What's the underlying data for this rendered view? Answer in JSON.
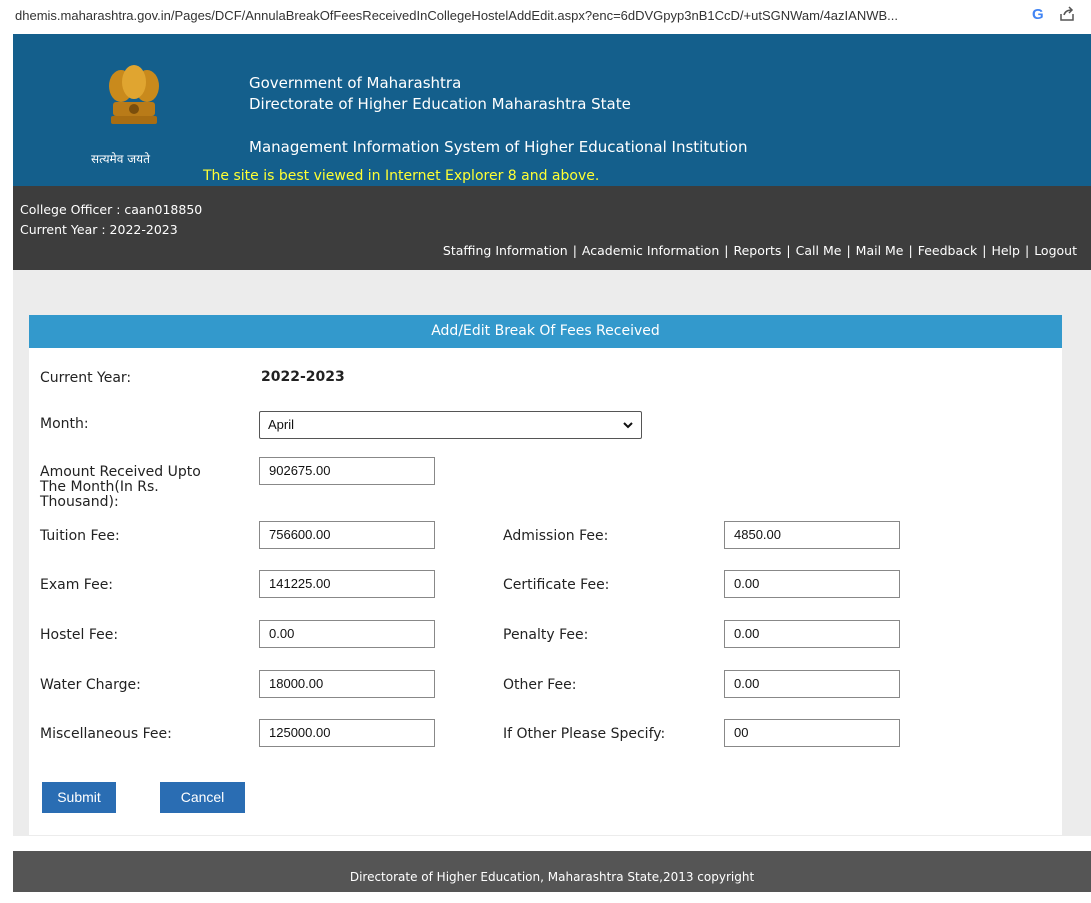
{
  "browser": {
    "url": "dhemis.maharashtra.gov.in/Pages/DCF/AnnulaBreakOfFeesReceivedInCollegeHostelAddEdit.aspx?enc=6dDVGpyp3nB1CcD/+utSGNWam/4azIANWB..."
  },
  "header": {
    "motto": "सत्यमेव जयते",
    "gov_title": "Government of Maharashtra",
    "dir_title": "Directorate of Higher Education Maharashtra State",
    "mis_title": "Management Information System of Higher Educational Institution",
    "notice": "The site is best viewed in Internet Explorer 8 and above."
  },
  "infobar": {
    "officer": "College Officer : caan018850",
    "current_year": "Current Year : 2022-2023",
    "nav": [
      "Staffing Information",
      "Academic Information",
      "Reports",
      "Call Me",
      "Mail Me",
      "Feedback",
      "Help",
      "Logout"
    ]
  },
  "form": {
    "title": "Add/Edit Break Of Fees Received",
    "current_year_label": "Current Year:",
    "current_year_value": "2022-2023",
    "month_label": "Month:",
    "month_value": "April",
    "amount_label_l1": "Amount Received Upto",
    "amount_label_l2": "The Month(In Rs.",
    "amount_label_l3": "Thousand):",
    "amount_value": "902675.00",
    "tuition_label": "Tuition Fee:",
    "tuition_value": "756600.00",
    "admission_label": "Admission Fee:",
    "admission_value": "4850.00",
    "exam_label": "Exam Fee:",
    "exam_value": "141225.00",
    "certificate_label": "Certificate Fee:",
    "certificate_value": "0.00",
    "hostel_label": "Hostel Fee:",
    "hostel_value": "0.00",
    "penalty_label": "Penalty Fee:",
    "penalty_value": "0.00",
    "water_label": "Water Charge:",
    "water_value": "18000.00",
    "other_label": "Other Fee:",
    "other_value": "0.00",
    "misc_label": "Miscellaneous Fee:",
    "misc_value": "125000.00",
    "specify_label": "If Other Please Specify:",
    "specify_value": "00",
    "submit_label": "Submit",
    "cancel_label": "Cancel"
  },
  "footer": {
    "copyright": "Directorate of Higher Education, Maharashtra State,2013 copyright"
  },
  "colors": {
    "header_bg": "#145f8c",
    "infobar_bg": "#3d3d3d",
    "panel_head_bg": "#3399cc",
    "button_bg": "#2a6db3",
    "footer_bg": "#555555",
    "notice_text": "#ffff33"
  },
  "icons": [
    "google-icon",
    "share-icon",
    "state-emblem-icon",
    "chevron-down-icon"
  ]
}
